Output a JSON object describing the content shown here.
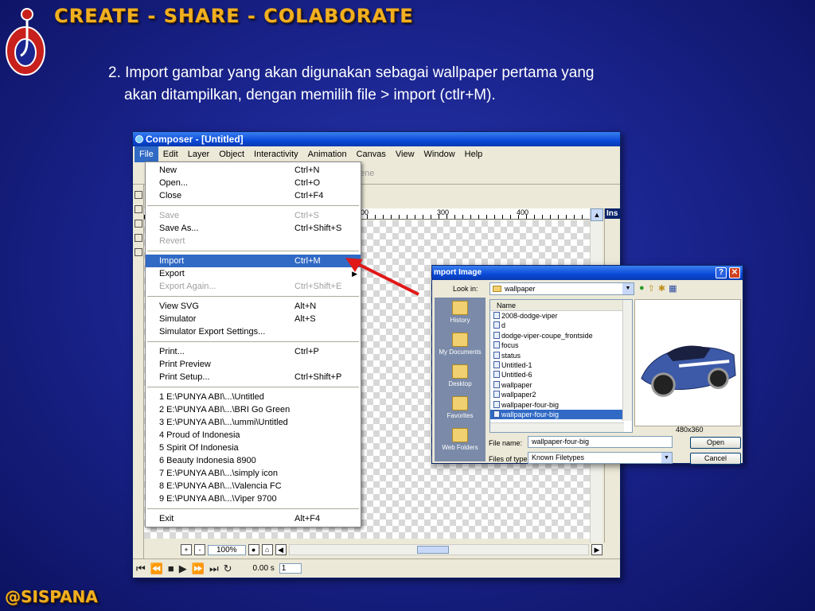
{
  "slide": {
    "title": "CREATE - SHARE - COLABORATE",
    "instruction_line1": "2. Import gambar yang akan digunakan sebagai wallpaper pertama yang",
    "instruction_line2": "akan ditampilkan, dengan memilih file > import (ctlr+M).",
    "footer": "@SISPANA",
    "accent_color": "#f0b020"
  },
  "app": {
    "title": "Composer - [Untitled]",
    "menus": [
      "File",
      "Edit",
      "Layer",
      "Object",
      "Interactivity",
      "Animation",
      "Canvas",
      "View",
      "Window",
      "Help"
    ],
    "toolbar_scene_label": "ene",
    "ruler_marks": [
      "00",
      "300",
      "400"
    ],
    "panel_tab": "Ins",
    "zoom": "100%",
    "time": "0.00 s",
    "frame": "1"
  },
  "file_menu": {
    "groups": [
      [
        {
          "label": "New",
          "shortcut": "Ctrl+N",
          "disabled": false
        },
        {
          "label": "Open...",
          "shortcut": "Ctrl+O",
          "disabled": false
        },
        {
          "label": "Close",
          "shortcut": "Ctrl+F4",
          "disabled": false
        }
      ],
      [
        {
          "label": "Save",
          "shortcut": "Ctrl+S",
          "disabled": true
        },
        {
          "label": "Save As...",
          "shortcut": "Ctrl+Shift+S",
          "disabled": false
        },
        {
          "label": "Revert",
          "shortcut": "",
          "disabled": true
        }
      ],
      [
        {
          "label": "Import",
          "shortcut": "Ctrl+M",
          "disabled": false,
          "highlighted": true
        },
        {
          "label": "Export",
          "shortcut": "",
          "disabled": false,
          "submenu": true
        },
        {
          "label": "Export Again...",
          "shortcut": "Ctrl+Shift+E",
          "disabled": true
        }
      ],
      [
        {
          "label": "View SVG",
          "shortcut": "Alt+N",
          "disabled": false
        },
        {
          "label": "Simulator",
          "shortcut": "Alt+S",
          "disabled": false
        },
        {
          "label": "Simulator Export Settings...",
          "shortcut": "",
          "disabled": false
        }
      ],
      [
        {
          "label": "Print...",
          "shortcut": "Ctrl+P",
          "disabled": false
        },
        {
          "label": "Print Preview",
          "shortcut": "",
          "disabled": false
        },
        {
          "label": "Print Setup...",
          "shortcut": "Ctrl+Shift+P",
          "disabled": false
        }
      ],
      [
        {
          "label": "1 E:\\PUNYA ABI\\...\\Untitled",
          "shortcut": "",
          "disabled": false
        },
        {
          "label": "2 E:\\PUNYA ABI\\...\\BRI Go Green",
          "shortcut": "",
          "disabled": false
        },
        {
          "label": "3 E:\\PUNYA ABI\\...\\ummi\\Untitled",
          "shortcut": "",
          "disabled": false
        },
        {
          "label": "4 Proud of Indonesia",
          "shortcut": "",
          "disabled": false
        },
        {
          "label": "5 Spirit Of Indonesia",
          "shortcut": "",
          "disabled": false
        },
        {
          "label": "6 Beauty Indonesia 8900",
          "shortcut": "",
          "disabled": false
        },
        {
          "label": "7 E:\\PUNYA ABI\\...\\simply icon",
          "shortcut": "",
          "disabled": false
        },
        {
          "label": "8 E:\\PUNYA ABI\\...\\Valencia FC",
          "shortcut": "",
          "disabled": false
        },
        {
          "label": "9 E:\\PUNYA ABI\\...\\Viper 9700",
          "shortcut": "",
          "disabled": false
        }
      ],
      [
        {
          "label": "Exit",
          "shortcut": "Alt+F4",
          "disabled": false
        }
      ]
    ]
  },
  "import_dialog": {
    "title": "mport Image",
    "look_in_label": "Look in:",
    "look_in_value": "wallpaper",
    "column_header": "Name",
    "places": [
      "History",
      "My Documents",
      "Desktop",
      "Favorites",
      "Web Folders"
    ],
    "files": [
      "2008-dodge-viper",
      "d",
      "dodge-viper-coupe_frontside",
      "focus",
      "status",
      "Untitled-1",
      "Untitled-6",
      "wallpaper",
      "wallpaper2",
      "wallpaper-four-big",
      "wallpaper-four-big"
    ],
    "selected_index": 10,
    "preview_dimensions": "480x360",
    "file_name_label": "File name:",
    "file_name_value": "wallpaper-four-big",
    "file_type_label": "Files of type:",
    "file_type_value": "Known Filetypes",
    "open_label": "Open",
    "cancel_label": "Cancel",
    "help_button": "?",
    "close_button": "✕"
  }
}
